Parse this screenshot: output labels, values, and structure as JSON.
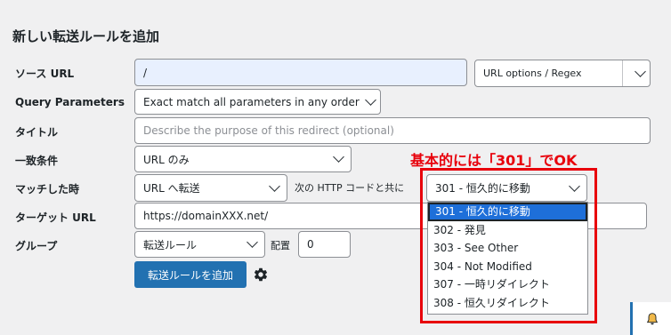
{
  "page_title": "新しい転送ルールを追加",
  "rows": {
    "source": {
      "label": "ソース URL",
      "value": "/",
      "options_label": "URL options / Regex"
    },
    "query": {
      "label": "Query Parameters",
      "value": "Exact match all parameters in any order"
    },
    "title": {
      "label": "タイトル",
      "placeholder": "Describe the purpose of this redirect (optional)"
    },
    "match": {
      "label": "一致条件",
      "value": "URL のみ"
    },
    "when_matched": {
      "label": "マッチした時",
      "value": "URL へ転送",
      "code_label": "次の HTTP コードと共に",
      "code_value": "301 - 恒久的に移動"
    },
    "target": {
      "label": "ターゲット URL",
      "value": "https://domainXXX.net/"
    },
    "group": {
      "label": "グループ",
      "value": "転送ルール",
      "position_label": "配置",
      "position_value": "0"
    }
  },
  "submit_label": "転送ルールを追加",
  "annotation": "基本的には「301」でOK",
  "http_code_options": [
    {
      "label": "301 - 恒久的に移動",
      "selected": true
    },
    {
      "label": "302 - 発見",
      "selected": false
    },
    {
      "label": "303 - See Other",
      "selected": false
    },
    {
      "label": "304 - Not Modified",
      "selected": false
    },
    {
      "label": "307 - 一時リダイレクト",
      "selected": false
    },
    {
      "label": "308 - 恒久リダイレクト",
      "selected": false
    }
  ],
  "colors": {
    "primary": "#2271b1",
    "annotation_red": "#e8000b",
    "selected_option": "#1e6fd9",
    "notification_bell": "#f0b849"
  },
  "icons": {
    "settings": "gear-icon",
    "notification": "bell-icon",
    "dropdown": "chevron-down-icon"
  }
}
